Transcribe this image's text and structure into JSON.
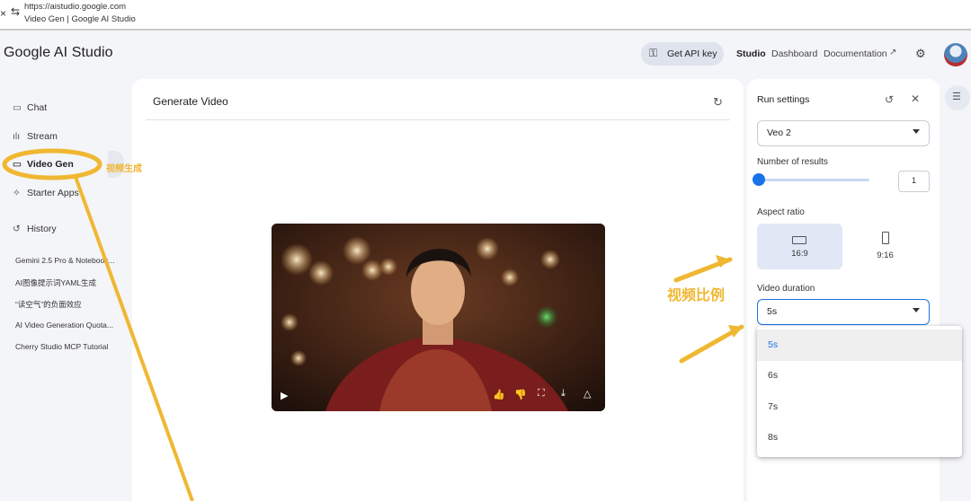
{
  "browser": {
    "url": "https://aistudio.google.com",
    "tab_title": "Video Gen | Google AI Studio",
    "close_glyph": "×",
    "tune_glyph": "⇆"
  },
  "header": {
    "brand": "Google AI Studio",
    "api_key_label": "Get API key",
    "nav": {
      "studio": "Studio",
      "dashboard": "Dashboard",
      "documentation": "Documentation"
    }
  },
  "sidebar": {
    "items": [
      {
        "label": "Chat",
        "icon": "chat-icon"
      },
      {
        "label": "Stream",
        "icon": "stream-icon"
      },
      {
        "label": "Video Gen",
        "icon": "video-icon"
      },
      {
        "label": "Starter Apps",
        "icon": "apps-icon"
      },
      {
        "label": "History",
        "icon": "history-icon"
      }
    ],
    "history": [
      "Gemini 2.5 Pro & Notebook...",
      "AI图像提示词YAML生成",
      "“读空气”的负面效应",
      "AI Video Generation Quota...",
      "Cherry Studio MCP Tutorial"
    ]
  },
  "main": {
    "title": "Generate Video"
  },
  "settings": {
    "title": "Run settings",
    "model": "Veo 2",
    "results_label": "Number of results",
    "results_value": "1",
    "results_fraction": 0.0,
    "aspect_label": "Aspect ratio",
    "aspect_options": [
      "16:9",
      "9:16"
    ],
    "aspect_selected": "16:9",
    "duration_label": "Video duration",
    "duration_value": "5s",
    "duration_options": [
      "5s",
      "6s",
      "7s",
      "8s"
    ],
    "accent_color": "#1a73e8"
  },
  "annotations": {
    "video_gen": "视频生成",
    "aspect_ratio": "视频比例",
    "color": "#f0b732"
  }
}
